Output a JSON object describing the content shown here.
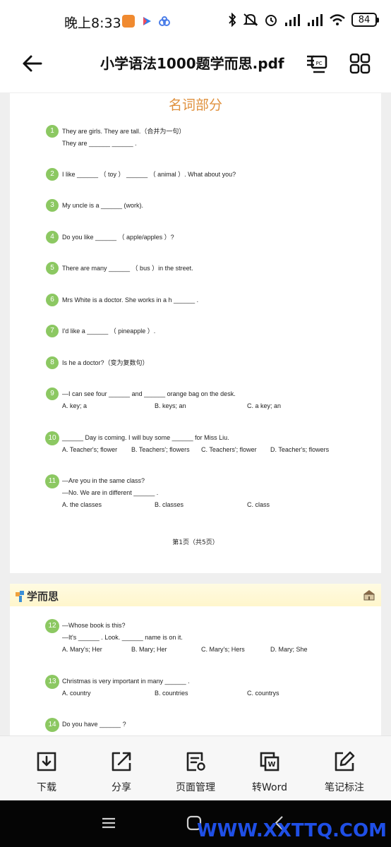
{
  "status_bar": {
    "time": "晚上8:33",
    "battery": "84"
  },
  "header": {
    "title": "小学语法1000题学而思.pdf"
  },
  "document": {
    "section_title": "名词部分",
    "questions": [
      {
        "num": "1",
        "lines": [
          "They are girls. They are tall.（合并为一句）",
          "They are ______ ______ ."
        ]
      },
      {
        "num": "2",
        "lines": [
          "I like ______ （ toy ） ______ （ animal ）. What about you?"
        ]
      },
      {
        "num": "3",
        "lines": [
          "My uncle is a ______ (work)."
        ]
      },
      {
        "num": "4",
        "lines": [
          "Do you like ______ （ apple/apples ）?"
        ]
      },
      {
        "num": "5",
        "lines": [
          "There are many ______ （ bus ）in the street."
        ]
      },
      {
        "num": "6",
        "lines": [
          "Mrs White is a doctor. She works in a h ______ ."
        ]
      },
      {
        "num": "7",
        "lines": [
          "I'd like a ______ （ pineapple ）."
        ]
      },
      {
        "num": "8",
        "lines": [
          "Is he a doctor?（变为复数句）"
        ]
      },
      {
        "num": "9",
        "lines": [
          "—I can see four ______ and ______ orange bag on the desk."
        ],
        "options": [
          "A.  key; a",
          "B.  keys; an",
          "C.  a key; an"
        ]
      },
      {
        "num": "10",
        "lines": [
          " ______ Day is coming. I will buy some ______ for Miss Liu."
        ],
        "options": [
          "A.  Teacher's; flower",
          "B.  Teachers'; flowers",
          "C.  Teachers'; flower",
          "D.  Teacher's; flowers"
        ]
      },
      {
        "num": "11",
        "lines": [
          "—Are you in the same class?",
          "—No. We are in different ______ ."
        ],
        "options": [
          "A.  the classes",
          "B.  classes",
          "C.  class"
        ]
      }
    ],
    "page1_footer": "第1页（共5页）",
    "page2_logo": "学而思",
    "page2_questions": [
      {
        "num": "12",
        "lines": [
          "—Whose book is this?",
          "—It's ______ . Look. ______ name is on it."
        ],
        "options": [
          "A.  Mary's; Her",
          "B.  Mary; Her",
          "C.  Mary's; Hers",
          "D.  Mary; She"
        ]
      },
      {
        "num": "13",
        "lines": [
          "Christmas is very important in many ______ ."
        ],
        "options": [
          "A.  country",
          "B.  countries",
          "C.  countrys"
        ]
      },
      {
        "num": "14",
        "lines": [
          "Do you have ______ ?"
        ]
      }
    ]
  },
  "toolbar": {
    "download": "下载",
    "share": "分享",
    "page_manage": "页面管理",
    "to_word": "转Word",
    "annotate": "笔记标注"
  },
  "watermark": "WWW.XXTTQ.COM",
  "colors": {
    "accent_orange": "#e0913e",
    "number_green": "#8cc862",
    "watermark_blue": "#1f4fe6"
  }
}
